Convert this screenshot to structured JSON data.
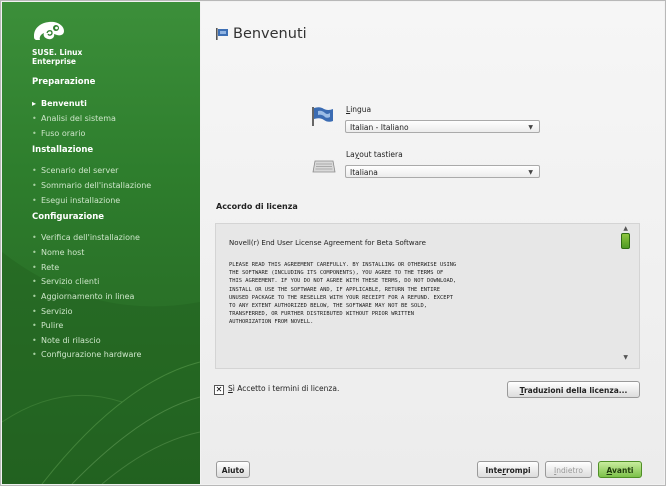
{
  "brand": {
    "line1": "SUSE. Linux",
    "line2": "Enterprise"
  },
  "sidebar": {
    "sections": [
      {
        "label": "Preparazione"
      },
      {
        "label": "Installazione"
      },
      {
        "label": "Configurazione"
      }
    ],
    "steps": [
      {
        "label": "Benvenuti",
        "active": true
      },
      {
        "label": "Analisi del sistema"
      },
      {
        "label": "Fuso orario"
      },
      {
        "label": "Scenario del server"
      },
      {
        "label": "Sommario dell'installazione"
      },
      {
        "label": "Esegui installazione"
      },
      {
        "label": "Verifica dell'installazione"
      },
      {
        "label": "Nome host"
      },
      {
        "label": "Rete"
      },
      {
        "label": "Servizio clienti"
      },
      {
        "label": "Aggiornamento in linea"
      },
      {
        "label": "Servizio"
      },
      {
        "label": "Pulire"
      },
      {
        "label": "Note di rilascio"
      },
      {
        "label": "Configurazione hardware"
      }
    ]
  },
  "main": {
    "title": "Benvenuti",
    "language": {
      "label_prefix": "",
      "label_u": "L",
      "label_rest": "ingua",
      "value": "Italian - Italiano"
    },
    "keyboard": {
      "label_prefix": "La",
      "label_u": "y",
      "label_rest": "out tastiera",
      "value": "Italiana"
    },
    "license_heading": "Accordo di licenza",
    "license_title": "Novell(r) End User License Agreement for Beta Software",
    "license_body": "PLEASE READ THIS AGREEMENT CAREFULLY. BY INSTALLING OR OTHERWISE USING\nTHE SOFTWARE (INCLUDING ITS COMPONENTS), YOU AGREE TO THE TERMS OF\nTHIS AGREEMENT. IF YOU DO NOT AGREE WITH THESE TERMS, DO NOT DOWNLOAD,\nINSTALL OR USE THE SOFTWARE AND, IF APPLICABLE, RETURN THE ENTIRE\nUNUSED PACKAGE TO THE RESELLER WITH YOUR RECEIPT FOR A REFUND. EXCEPT\nTO ANY EXTENT AUTHORIZED BELOW, THE SOFTWARE MAY NOT BE SOLD,\nTRANSFERRED, OR FURTHER DISTRIBUTED WITHOUT PRIOR WRITTEN\nAUTHORIZATION FROM NOVELL.",
    "accept": {
      "checked_mark": "✕",
      "u": "S",
      "rest": "ì Accetto i termini di licenza."
    },
    "translations_button": {
      "u": "T",
      "rest": "raduzioni della licenza..."
    }
  },
  "buttons": {
    "help": "Aiuto",
    "abort": {
      "pre": "Inte",
      "u": "r",
      "rest": "rompi"
    },
    "back": {
      "u": "I",
      "rest": "ndietro"
    },
    "next": {
      "u": "A",
      "rest": "vanti"
    }
  },
  "colors": {
    "sidebar_green": "#2e7e2d",
    "next_green": "#7cc14a"
  },
  "icons": [
    "suse-chameleon-logo",
    "flag-icon",
    "keyboard-icon",
    "scroll-thumb"
  ]
}
